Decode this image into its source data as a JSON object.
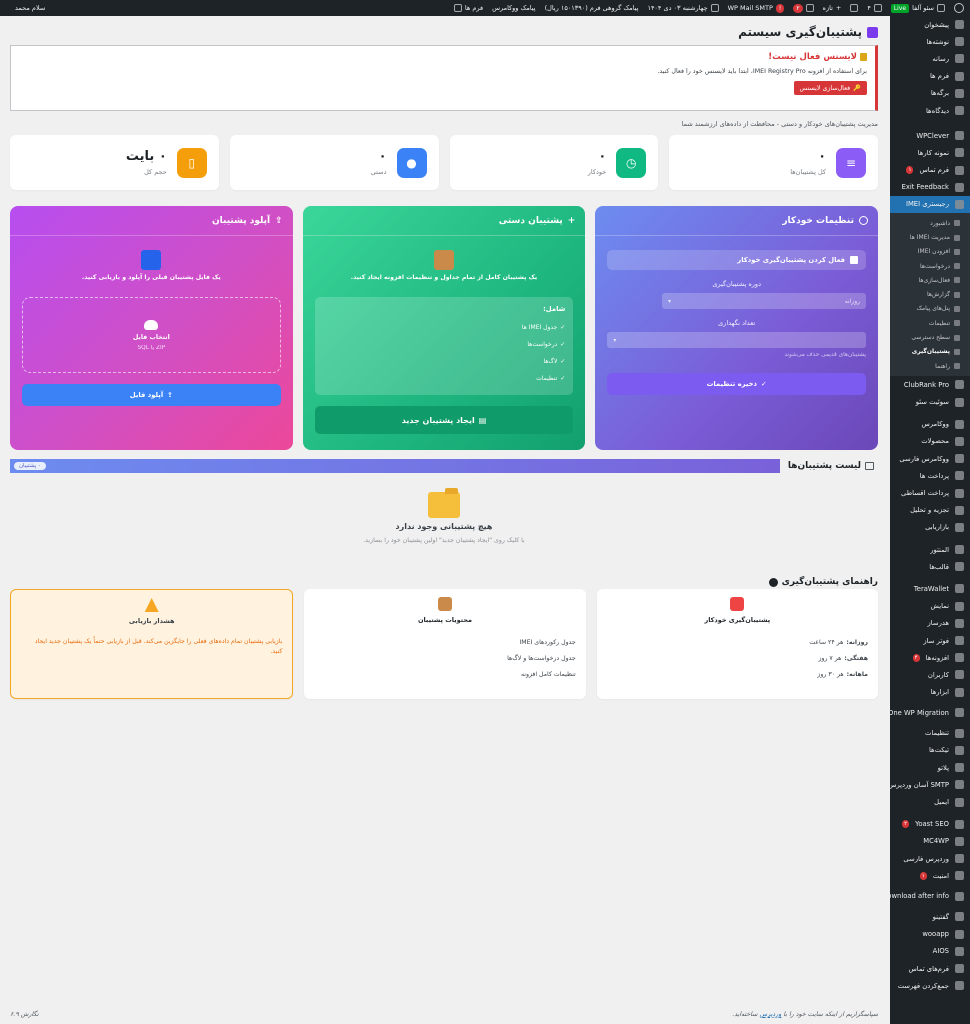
{
  "adminbar": {
    "site_name": "سئو آلفا",
    "live": "Live",
    "updates_count": "۴",
    "new_label": "تازه",
    "seo_badge": "۲",
    "smtp_label": "WP Mail SMTP",
    "smtp_badge": "!",
    "date_text": "چهارشنبه ۰۳ دی ۱۴۰۴",
    "sms_text": "پیامک گروهی فرم (۱۵۰۱۳۹۰ ریال)",
    "woo_sms": "پیامک ووکامرس",
    "forms": "فرم ها",
    "greeting": "سلام محمد"
  },
  "sidebar": {
    "items": [
      {
        "label": "پیشخوان"
      },
      {
        "label": "نوشته‌ها"
      },
      {
        "label": "رسانه"
      },
      {
        "label": "فرم ها"
      },
      {
        "label": "برگه‌ها"
      },
      {
        "label": "دیدگاه‌ها"
      },
      {
        "label": "WPClever"
      },
      {
        "label": "نمونه کارها"
      },
      {
        "label": "فرم تماس",
        "badge": "۱"
      },
      {
        "label": "Exit Feedback"
      },
      {
        "label": "رجیستری IMEI"
      }
    ],
    "submenu": [
      {
        "label": "داشبورد"
      },
      {
        "label": "مدیریت IMEI ها"
      },
      {
        "label": "افزودن IMEI"
      },
      {
        "label": "درخواست‌ها"
      },
      {
        "label": "فعال‌سازی‌ها"
      },
      {
        "label": "گزارش‌ها"
      },
      {
        "label": "پنل‌های پیامک"
      },
      {
        "label": "تنظیمات"
      },
      {
        "label": "سطح دسترسی"
      },
      {
        "label": "پشتیبان‌گیری"
      },
      {
        "label": "راهنما"
      }
    ],
    "items2": [
      {
        "label": "ClubRank Pro"
      },
      {
        "label": "سوئیت سئو"
      },
      {
        "label": "ووکامرس"
      },
      {
        "label": "محصولات"
      },
      {
        "label": "ووکامرس فارسی"
      },
      {
        "label": "پرداخت ها"
      },
      {
        "label": "پرداخت اقساطی"
      },
      {
        "label": "تجزیه و تحلیل"
      },
      {
        "label": "بازاریابی"
      },
      {
        "label": "المنتور"
      },
      {
        "label": "قالب‌ها"
      },
      {
        "label": "TeraWallet"
      },
      {
        "label": "نمایش"
      },
      {
        "label": "هدرساز"
      },
      {
        "label": "فوتر ساز"
      },
      {
        "label": "افزونه‌ها",
        "badge": "۴"
      },
      {
        "label": "کاربران"
      },
      {
        "label": "ابزارها"
      },
      {
        "label": "All-in-One WP Migration"
      },
      {
        "label": "تنظیمات"
      },
      {
        "label": "تیکت‌ها"
      },
      {
        "label": "پلاتو"
      },
      {
        "label": "SMTP آسان وردپرس"
      },
      {
        "label": "ایمیل"
      },
      {
        "label": "Yoast SEO",
        "badge": "۲"
      },
      {
        "label": "MC4WP"
      },
      {
        "label": "وردپرس فارسی"
      },
      {
        "label": "امنیت",
        "badge": "۱"
      },
      {
        "label": "Download after info"
      },
      {
        "label": "گفتینو"
      },
      {
        "label": "wooapp"
      },
      {
        "label": "AIOS"
      },
      {
        "label": "فرم‌های تماس"
      },
      {
        "label": "جمع‌کردن فهرست"
      }
    ]
  },
  "page": {
    "title": "پشتیبان‌گیری سیستم",
    "subtitle": "مدیریت پشتیبان‌های خودکار و دستی - محافظت از داده‌های ارزشمند شما"
  },
  "notice": {
    "title": "لایسنس فعال نیست!",
    "text": "برای استفاده از افزونه IMEI Registry Pro، ابتدا باید لایسنس خود را فعال کنید.",
    "button": "فعال‌سازی لایسنس"
  },
  "stats": [
    {
      "value": "۰",
      "label": "کل پشتیبان‌ها",
      "color": "#8b5cf6"
    },
    {
      "value": "۰",
      "label": "خودکار",
      "color": "#10b981"
    },
    {
      "value": "۰",
      "label": "دستی",
      "color": "#3b82f6"
    },
    {
      "value": "۰ بایت",
      "label": "حجم کل",
      "color": "#f59e0b"
    }
  ],
  "auto_panel": {
    "title": "تنظیمات خودکار",
    "enable_label": "فعال کردن پشتیبان‌گیری خودکار",
    "period_label": "دوره پشتیبان‌گیری",
    "period_value": "روزانه",
    "keep_label": "تعداد نگهداری",
    "keep_hint": "پشتیبان‌های قدیمی حذف می‌شوند",
    "save_button": "ذخیره تنظیمات"
  },
  "manual_panel": {
    "title": "پشتیبان دستی",
    "desc": "یک پشتیبان کامل از تمام جداول و تنظیمات افزونه ایجاد کنید.",
    "includes_title": "شامل:",
    "includes": [
      "جدول IMEI ها",
      "درخواست‌ها",
      "لاگ‌ها",
      "تنظیمات"
    ],
    "create_button": "ایجاد پشتیبان جدید"
  },
  "upload_panel": {
    "title": "آپلود پشتیبان",
    "desc": "یک فایل پشتیبان قبلی را آپلود و بازیابی کنید.",
    "choose_label": "انتخاب فایل",
    "formats": "ZIP یا SQL",
    "upload_button": "آپلود فایل"
  },
  "list": {
    "title": "لیست پشتیبان‌ها",
    "badge": "۰ پشتیبان",
    "empty_title": "هیچ پشتیبانی وجود ندارد",
    "empty_sub": "با کلیک روی \"ایجاد پشتیبان جدید\" اولین پشتیبان خود را بسازید."
  },
  "guide": {
    "title": "راهنمای پشتیبان‌گیری",
    "auto": {
      "head": "پشتیبان‌گیری خودکار",
      "lines": [
        {
          "k": "روزانه:",
          "v": "هر ۲۴ ساعت"
        },
        {
          "k": "هفتگی:",
          "v": "هر ۷ روز"
        },
        {
          "k": "ماهانه:",
          "v": "هر ۳۰ روز"
        }
      ]
    },
    "contents": {
      "head": "محتویات پشتیبان",
      "lines": [
        "جدول رکوردهای IMEI",
        "جدول درخواست‌ها و لاگ‌ها",
        "تنظیمات کامل افزونه"
      ]
    },
    "warning": {
      "head": "هشدار بازیابی",
      "text": "بازیابی پشتیبان تمام داده‌های فعلی را جایگزین می‌کند. قبل از بازیابی حتماً یک پشتیبان جدید ایجاد کنید."
    }
  },
  "footer": {
    "thanks_pre": "سپاسگزاریم از اینکه سایت خود را با",
    "wp_link": "وردپرس",
    "thanks_post": "ساخته‌اید.",
    "version": "نگارش ۶.۹"
  }
}
